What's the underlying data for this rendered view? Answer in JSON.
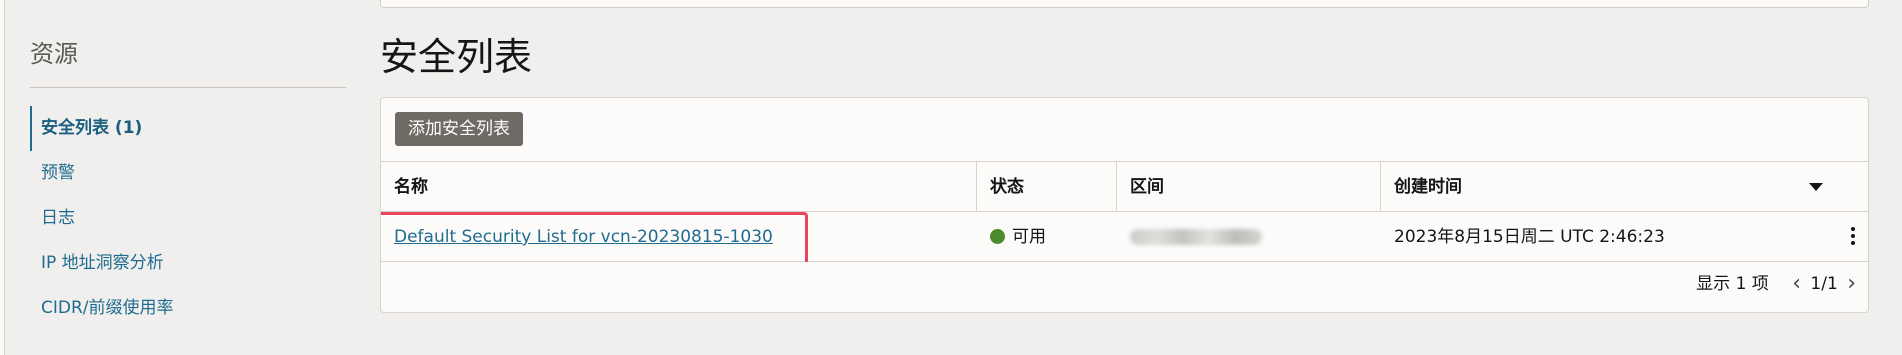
{
  "sidebar": {
    "title": "资源",
    "items": [
      {
        "label": "安全列表 (1)",
        "active": true
      },
      {
        "label": "预警",
        "active": false
      },
      {
        "label": "日志",
        "active": false
      },
      {
        "label": "IP 地址洞察分析",
        "active": false
      },
      {
        "label": "CIDR/前缀使用率",
        "active": false
      }
    ]
  },
  "main": {
    "title": "安全列表",
    "add_button": "添加安全列表",
    "table": {
      "headers": [
        "名称",
        "状态",
        "区间",
        "创建时间"
      ],
      "rows": [
        {
          "name": "Default Security List for vcn-20230815-1030",
          "status": "可用",
          "created": "2023年8月15日周二 UTC 2:46:23"
        }
      ]
    },
    "pager": {
      "count": "显示 1 项",
      "page": "1/1"
    }
  },
  "colors": {
    "link": "#1f6c90",
    "button_bg": "#6f6a64",
    "status_available": "#4c8b2b",
    "highlight": "#e8455f"
  },
  "icons": [
    "sort-down-icon",
    "kebab-menu-icon",
    "chevron-left-icon",
    "chevron-right-icon",
    "status-dot-icon"
  ]
}
